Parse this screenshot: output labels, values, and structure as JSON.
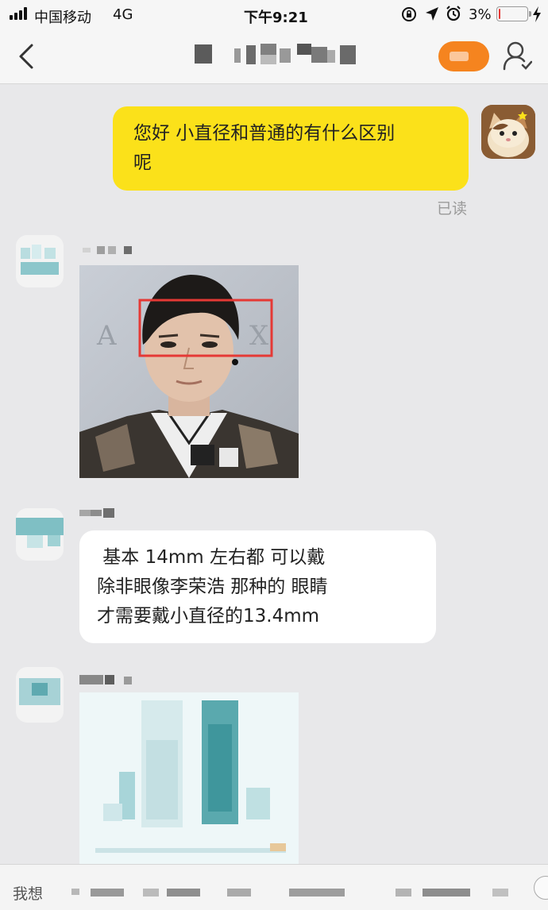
{
  "status_bar": {
    "carrier": "中国移动",
    "network": "4G",
    "time": "下午9:21",
    "battery_percent": "3%",
    "battery_level": 0.03
  },
  "header": {
    "back_icon": "chevron-left-icon",
    "profile_icon": "user-profile-icon"
  },
  "messages": [
    {
      "from": "me",
      "type": "text",
      "lines": [
        "您好 小直径和普通的有什么区别",
        "呢"
      ],
      "status": "已读",
      "bubble_color": "#fbe11a"
    },
    {
      "from": "shop",
      "type": "image",
      "description_icon": "photo-icon"
    },
    {
      "from": "shop",
      "type": "text",
      "lines": [
        " 基本 14mm 左右都 可以戴",
        "除非眼像李荣浩 那种的 眼睛",
        "才需要戴小直径的13.4mm"
      ],
      "bubble_color": "#ffffff"
    },
    {
      "from": "shop",
      "type": "image",
      "description_icon": "product-image-icon"
    }
  ],
  "input_bar": {
    "prefix": "我想"
  },
  "colors": {
    "accent_orange": "#f5841f",
    "highlight_red": "#e53935",
    "my_bubble": "#fbe11a",
    "chat_background": "#e8e8ea"
  }
}
